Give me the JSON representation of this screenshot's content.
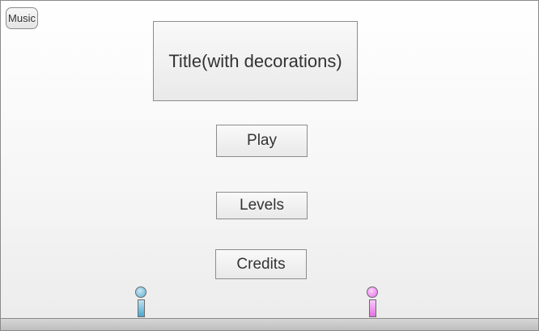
{
  "music_button": {
    "label": "Music"
  },
  "title": {
    "text": "Title(with decorations)"
  },
  "menu": {
    "play_label": "Play",
    "levels_label": "Levels",
    "credits_label": "Credits"
  },
  "characters": [
    {
      "name": "blue-character-icon",
      "color": "#5fb2d6"
    },
    {
      "name": "pink-character-icon",
      "color": "#e86be8"
    }
  ]
}
